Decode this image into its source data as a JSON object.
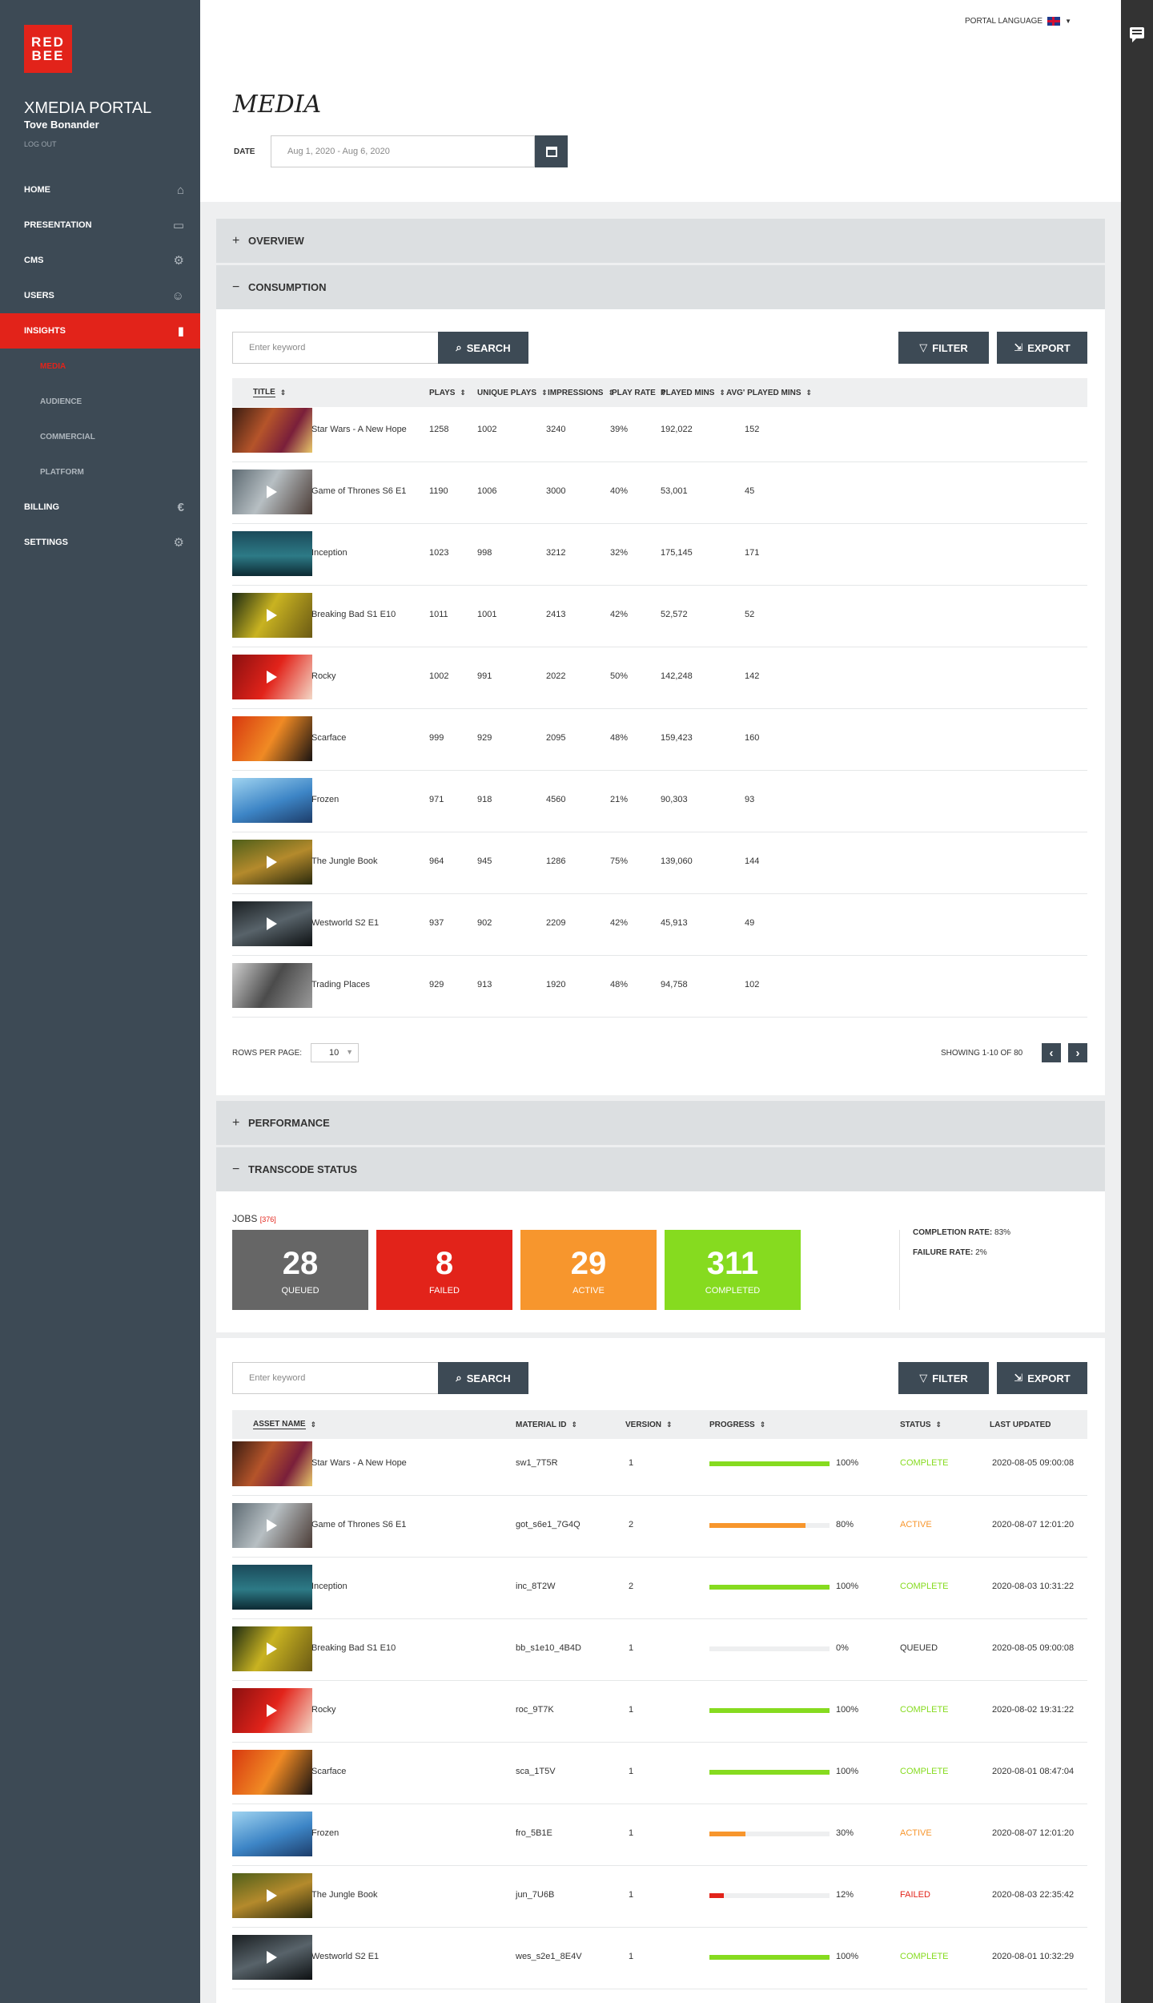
{
  "app": {
    "logo_top": "RED",
    "logo_bottom": "BEE",
    "portal_name": "XMEDIA PORTAL",
    "user_name": "Tove Bonander",
    "logout": "LOG OUT",
    "portal_language": "PORTAL LANGUAGE"
  },
  "nav": {
    "home": "HOME",
    "presentation": "PRESENTATION",
    "cms": "CMS",
    "users": "USERS",
    "insights": "INSIGHTS",
    "media": "MEDIA",
    "audience": "AUDIENCE",
    "commercial": "COMMERCIAL",
    "platform": "PLATFORM",
    "billing": "BILLING",
    "settings": "SETTINGS"
  },
  "page": {
    "title": "MEDIA",
    "date_label": "DATE",
    "date_value": "Aug 1, 2020 - Aug 6, 2020"
  },
  "panels": {
    "overview": "OVERVIEW",
    "consumption": "CONSUMPTION",
    "performance": "PERFORMANCE",
    "transcode": "TRANSCODE STATUS"
  },
  "consumption": {
    "search_placeholder": "Enter keyword",
    "search_label": "SEARCH",
    "filter_label": "FILTER",
    "export_label": "EXPORT",
    "columns": [
      "TITLE",
      "PLAYS",
      "UNIQUE PLAYS",
      "IMPRESSIONS",
      "PLAY RATE",
      "PLAYED MINS",
      "AVG' PLAYED MINS"
    ],
    "rows": [
      {
        "title": "Star Wars - A New Hope",
        "plays": "1258",
        "unique": "1002",
        "impressions": "3240",
        "rate": "39%",
        "mins": "192,022",
        "avg": "152"
      },
      {
        "title": "Game of Thrones S6 E1",
        "plays": "1190",
        "unique": "1006",
        "impressions": "3000",
        "rate": "40%",
        "mins": "53,001",
        "avg": "45"
      },
      {
        "title": "Inception",
        "plays": "1023",
        "unique": "998",
        "impressions": "3212",
        "rate": "32%",
        "mins": "175,145",
        "avg": "171"
      },
      {
        "title": "Breaking Bad S1 E10",
        "plays": "1011",
        "unique": "1001",
        "impressions": "2413",
        "rate": "42%",
        "mins": "52,572",
        "avg": "52"
      },
      {
        "title": "Rocky",
        "plays": "1002",
        "unique": "991",
        "impressions": "2022",
        "rate": "50%",
        "mins": "142,248",
        "avg": "142"
      },
      {
        "title": "Scarface",
        "plays": "999",
        "unique": "929",
        "impressions": "2095",
        "rate": "48%",
        "mins": "159,423",
        "avg": "160"
      },
      {
        "title": "Frozen",
        "plays": "971",
        "unique": "918",
        "impressions": "4560",
        "rate": "21%",
        "mins": "90,303",
        "avg": "93"
      },
      {
        "title": "The Jungle Book",
        "plays": "964",
        "unique": "945",
        "impressions": "1286",
        "rate": "75%",
        "mins": "139,060",
        "avg": "144"
      },
      {
        "title": "Westworld S2 E1",
        "plays": "937",
        "unique": "902",
        "impressions": "2209",
        "rate": "42%",
        "mins": "45,913",
        "avg": "49"
      },
      {
        "title": "Trading Places",
        "plays": "929",
        "unique": "913",
        "impressions": "1920",
        "rate": "48%",
        "mins": "94,758",
        "avg": "102"
      }
    ],
    "rows_per_page_label": "ROWS PER PAGE:",
    "rows_per_page_value": "10",
    "showing": "SHOWING 1-10 OF 80"
  },
  "transcode": {
    "jobs_label": "JOBS",
    "jobs_count": "[376]",
    "tiles": [
      {
        "num": "28",
        "label": "QUEUED",
        "color": "#666666"
      },
      {
        "num": "8",
        "label": "FAILED",
        "color": "#e2231a"
      },
      {
        "num": "29",
        "label": "ACTIVE",
        "color": "#f7962d"
      },
      {
        "num": "311",
        "label": "COMPLETED",
        "color": "#86db1f"
      }
    ],
    "completion_label": "COMPLETION RATE:",
    "completion_value": "83%",
    "failure_label": "FAILURE RATE:",
    "failure_value": "2%",
    "search_placeholder": "Enter keyword",
    "search_label": "SEARCH",
    "filter_label": "FILTER",
    "export_label": "EXPORT",
    "columns": [
      "ASSET NAME",
      "MATERIAL ID",
      "VERSION",
      "PROGRESS",
      "STATUS",
      "LAST UPDATED"
    ],
    "rows": [
      {
        "title": "Star Wars - A New Hope",
        "material": "sw1_7T5R",
        "version": "1",
        "progress": 100,
        "progress_text": "100%",
        "status": "COMPLETE",
        "updated": "2020-08-05 09:00:08"
      },
      {
        "title": "Game of Thrones S6 E1",
        "material": "got_s6e1_7G4Q",
        "version": "2",
        "progress": 80,
        "progress_text": "80%",
        "status": "ACTIVE",
        "updated": "2020-08-07 12:01:20"
      },
      {
        "title": "Inception",
        "material": "inc_8T2W",
        "version": "2",
        "progress": 100,
        "progress_text": "100%",
        "status": "COMPLETE",
        "updated": "2020-08-03 10:31:22"
      },
      {
        "title": "Breaking Bad S1 E10",
        "material": "bb_s1e10_4B4D",
        "version": "1",
        "progress": 0,
        "progress_text": "0%",
        "status": "QUEUED",
        "updated": "2020-08-05 09:00:08"
      },
      {
        "title": "Rocky",
        "material": "roc_9T7K",
        "version": "1",
        "progress": 100,
        "progress_text": "100%",
        "status": "COMPLETE",
        "updated": "2020-08-02 19:31:22"
      },
      {
        "title": "Scarface",
        "material": "sca_1T5V",
        "version": "1",
        "progress": 100,
        "progress_text": "100%",
        "status": "COMPLETE",
        "updated": "2020-08-01 08:47:04"
      },
      {
        "title": "Frozen",
        "material": "fro_5B1E",
        "version": "1",
        "progress": 30,
        "progress_text": "30%",
        "status": "ACTIVE",
        "updated": "2020-08-07 12:01:20"
      },
      {
        "title": "The Jungle Book",
        "material": "jun_7U6B",
        "version": "1",
        "progress": 12,
        "progress_text": "12%",
        "status": "FAILED",
        "updated": "2020-08-03 22:35:42"
      },
      {
        "title": "Westworld S2 E1",
        "material": "wes_s2e1_8E4V",
        "version": "1",
        "progress": 100,
        "progress_text": "100%",
        "status": "COMPLETE",
        "updated": "2020-08-01 10:32:29"
      }
    ]
  },
  "colors": {
    "brand_red": "#e2231a",
    "sidebar": "#3d4a55",
    "complete": "#86db1f",
    "active": "#f7962d",
    "failed": "#e2231a"
  }
}
